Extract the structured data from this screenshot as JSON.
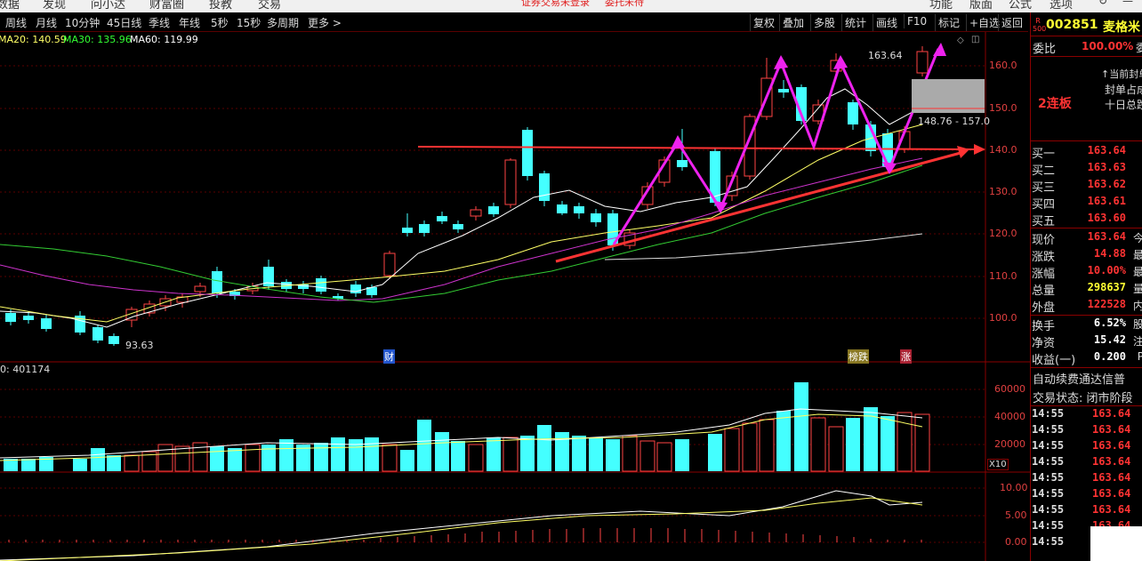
{
  "menu": {
    "items": [
      "数据",
      "发现",
      "问小达",
      "财富圈",
      "投教",
      "交易"
    ],
    "notice": "证券交易未登录",
    "notice2": "委托未待",
    "right_items": [
      "功能",
      "版面",
      "公式",
      "选项"
    ]
  },
  "toolbar": {
    "periods": [
      "周线",
      "月线",
      "10分钟",
      "45日线",
      "季线",
      "年线",
      "5秒",
      "15秒",
      "多周期",
      "更多 >"
    ],
    "actions": [
      "复权",
      "叠加",
      "多股",
      "统计",
      "画线",
      "F10",
      "标记",
      "+自选",
      "返回"
    ]
  },
  "ma_legend": [
    {
      "label": "MA20: 140.59",
      "color": "#ffff66"
    },
    {
      "label": "MA30: 135.96",
      "color": "#33ff33"
    },
    {
      "label": "MA60: 119.99",
      "color": "#ffffff"
    }
  ],
  "price_axis": [
    "160.0",
    "150.0",
    "140.0",
    "130.0",
    "120.0",
    "110.0",
    "100.0"
  ],
  "volume_axis": [
    "60000",
    "40000",
    "20000"
  ],
  "volume_unit": "X10",
  "volume_label": "0: 401174",
  "macd_axis": [
    "10.00",
    "5.00",
    "0.00"
  ],
  "annotations": {
    "high": "163.64",
    "low": "93.63",
    "range_box": "148.76 - 157.0",
    "tag_cai": "财",
    "tag_bang": "榜跌",
    "tag_zhang": "涨"
  },
  "stock": {
    "badge": "R",
    "badge_sub": "500",
    "code": "002851",
    "name": "麦格米",
    "weibi_label": "委比",
    "weibi": "100.00%",
    "weibi_unit": "委",
    "status": "2连板",
    "status_notes": [
      "当前封单",
      "封单占成",
      "十日总跌"
    ]
  },
  "order_book": [
    {
      "label": "买一",
      "price": "163.64"
    },
    {
      "label": "买二",
      "price": "163.63"
    },
    {
      "label": "买三",
      "price": "163.62"
    },
    {
      "label": "买四",
      "price": "163.61"
    },
    {
      "label": "买五",
      "price": "163.60"
    }
  ],
  "quote": [
    {
      "label": "现价",
      "value": "163.64",
      "unit": "今",
      "color": "#ff3333"
    },
    {
      "label": "涨跌",
      "value": "14.88",
      "unit": "最",
      "color": "#ff3333"
    },
    {
      "label": "涨幅",
      "value": "10.00%",
      "unit": "最",
      "color": "#ff3333"
    },
    {
      "label": "总量",
      "value": "298637",
      "unit": "量",
      "color": "#ffff33"
    },
    {
      "label": "外盘",
      "value": "122528",
      "unit": "内",
      "color": "#ff3333"
    },
    {
      "label": "换手",
      "value": "6.52%",
      "unit": "股",
      "color": "#ffffff"
    },
    {
      "label": "净资",
      "value": "15.42",
      "unit": "注",
      "color": "#ffffff"
    },
    {
      "label": "收益(一)",
      "value": "0.200",
      "unit": "P",
      "color": "#ffffff"
    }
  ],
  "notice_text": "自动续费通达信普",
  "trade_status": "交易状态: 闭市阶段",
  "ticks": [
    {
      "time": "14:55",
      "price": "163.64"
    },
    {
      "time": "14:55",
      "price": "163.64"
    },
    {
      "time": "14:55",
      "price": "163.64"
    },
    {
      "time": "14:55",
      "price": "163.64"
    },
    {
      "time": "14:55",
      "price": "163.64"
    },
    {
      "time": "14:55",
      "price": "163.64"
    },
    {
      "time": "14:55",
      "price": "163.64"
    },
    {
      "time": "14:55",
      "price": "163.64"
    },
    {
      "time": "14:55",
      "price": ""
    }
  ]
}
